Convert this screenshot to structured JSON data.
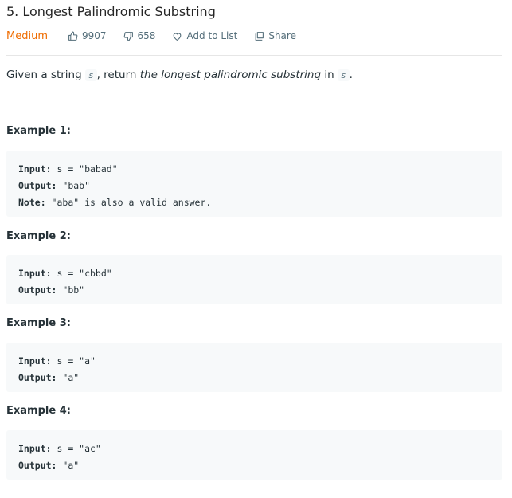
{
  "problem": {
    "title": "5. Longest Palindromic Substring",
    "difficulty": "Medium",
    "likes": "9907",
    "dislikes": "658",
    "add_to_list_label": "Add to List",
    "share_label": "Share"
  },
  "description": {
    "prefix": "Given a string ",
    "var1": "s",
    "middle": ", return ",
    "emphasis": "the longest palindromic substring",
    "in_text": " in ",
    "var2": "s",
    "suffix": "."
  },
  "examples": [
    {
      "title": "Example 1:",
      "lines": [
        {
          "label": "Input:",
          "value": " s = \"babad\""
        },
        {
          "label": "Output:",
          "value": " \"bab\""
        },
        {
          "label": "Note:",
          "value": " \"aba\" is also a valid answer."
        }
      ]
    },
    {
      "title": "Example 2:",
      "lines": [
        {
          "label": "Input:",
          "value": " s = \"cbbd\""
        },
        {
          "label": "Output:",
          "value": " \"bb\""
        }
      ]
    },
    {
      "title": "Example 3:",
      "lines": [
        {
          "label": "Input:",
          "value": " s = \"a\""
        },
        {
          "label": "Output:",
          "value": " \"a\""
        }
      ]
    },
    {
      "title": "Example 4:",
      "lines": [
        {
          "label": "Input:",
          "value": " s = \"ac\""
        },
        {
          "label": "Output:",
          "value": " \"a\""
        }
      ]
    }
  ],
  "colors": {
    "difficulty_medium": "#ef6c00",
    "code_background": "#f7f9fa",
    "meta_text": "#546e7a"
  },
  "icons": {
    "likes": "thumbs-up-icon",
    "dislikes": "thumbs-down-icon",
    "add_to_list": "heart-icon",
    "share": "share-icon"
  }
}
